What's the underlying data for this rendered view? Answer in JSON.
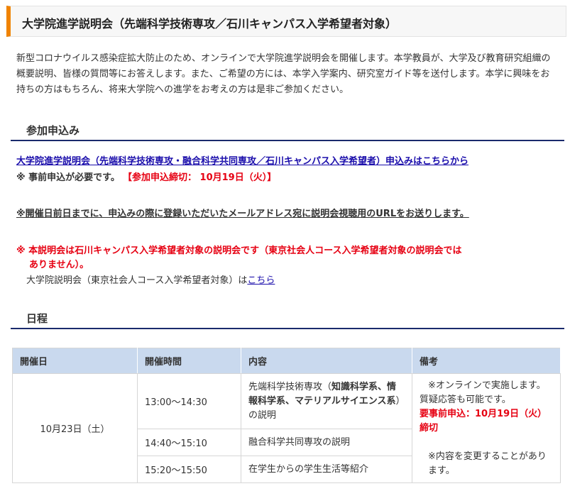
{
  "page": {
    "title": "大学院進学説明会（先端科学技術専攻／石川キャンパス入学希望者対象）",
    "intro": "新型コロナウイルス感染症拡大防止のため、オンラインで大学院進学説明会を開催します。本学教員が、大学及び教育研究組織の概要説明、皆様の質問等にお答えします。また、ご希望の方には、本学入学案内、研究室ガイド等を送付します。本学に興味をお持ちの方はもちろん、将来大学院への進学をお考えの方は是非ご参加ください。"
  },
  "application": {
    "heading": "参加申込み",
    "apply_link": "大学院進学説明会（先端科学技術専攻・融合科学共同専攻／石川キャンパス入学希望者）申込みはこちらから",
    "required_note": "※ 事前申込が必要です。",
    "deadline": "【参加申込締切： 10月19日（火）】",
    "url_note": "※開催日前日までに、申込みの際に登録いただいたメールアドレス宛に説明会視聴用のURLをお送りします。",
    "warning_line1": "※ 本説明会は石川キャンパス入学希望者対象の説明会です（東京社会人コース入学希望者対象の説明会では",
    "warning_line2": "ありません）。",
    "tokyo_text": "大学院説明会（東京社会人コース入学希望者対象）は",
    "tokyo_link": "こちら"
  },
  "schedule": {
    "heading": "日程",
    "headers": [
      "開催日",
      "開催時間",
      "内容",
      "備考"
    ],
    "date": "10月23日（土）",
    "rows": [
      {
        "time": "13:00～14:30",
        "content_pre": "先端科学技術専攻（",
        "content_bold": "知識科学系、情報科学系、マテリアルサイエンス系",
        "content_post": "）の説明"
      },
      {
        "time": "14:40～15:10",
        "content": "融合科学共同専攻の説明"
      },
      {
        "time": "15:20～15:50",
        "content": "在学生からの学生生活等紹介"
      }
    ],
    "notes": {
      "line1": "※オンラインで実施します。",
      "line2": "質疑応答も可能です。",
      "line3": "要事前申込：10月19日（火）締切",
      "line4": "※内容を変更することがあります。"
    }
  },
  "colors": {
    "accent": "#f08300",
    "heading_rule": "#1a2a6c",
    "warning": "#e60012",
    "link": "#1a0dab",
    "table_header": "#c9d9ee"
  }
}
